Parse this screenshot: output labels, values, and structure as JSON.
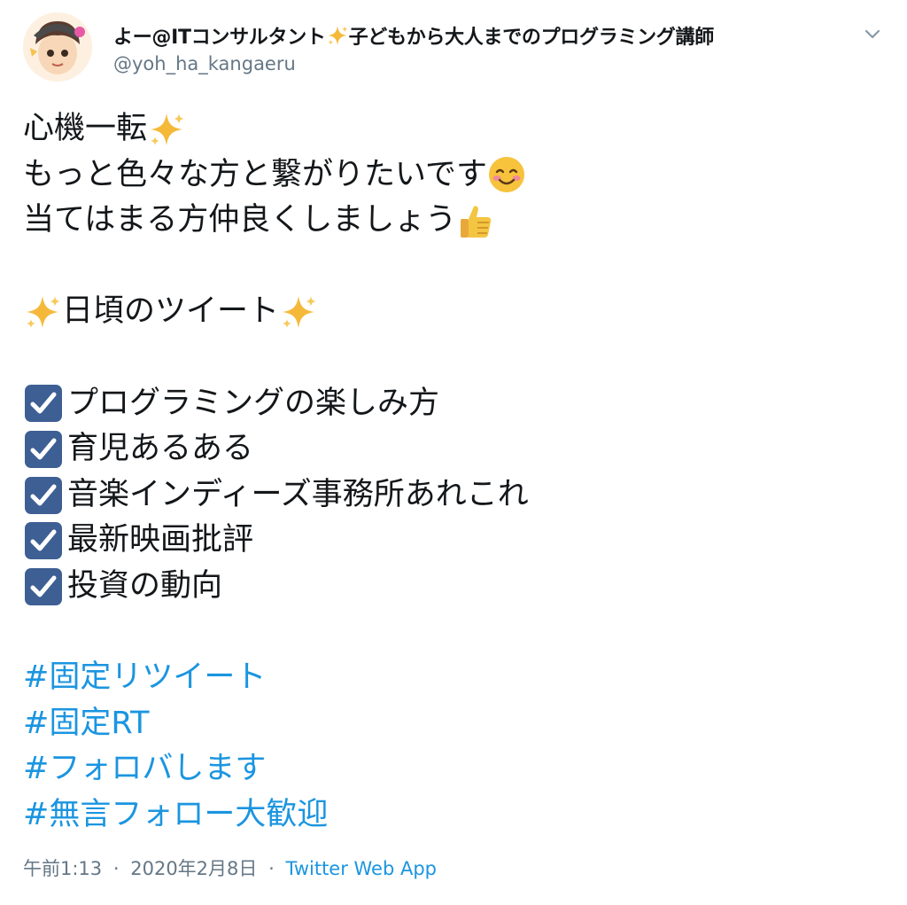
{
  "user": {
    "display_name": "よー@ITコンサルタント",
    "display_name_suffix": "子どもから大人までのプログラミング講師",
    "handle": "@yoh_ha_kangaeru"
  },
  "tweet": {
    "line1": "心機一転",
    "line2": "もっと色々な方と繋がりたいです",
    "line3": "当てはまる方仲良くしましょう",
    "section_title": "日頃のツイート",
    "topics": [
      "プログラミングの楽しみ方",
      "育児あるある",
      "音楽インディーズ事務所あれこれ",
      "最新映画批評",
      "投資の動向"
    ],
    "hashtags": [
      "#固定リツイート",
      "#固定RT",
      "#フォロバします",
      "#無言フォロー大歓迎"
    ]
  },
  "meta": {
    "time": "午前1:13",
    "separator": "·",
    "date": "2020年2月8日",
    "source": "Twitter Web App"
  },
  "icons": {
    "sparkles": "sparkles-icon",
    "smile": "smiling-face-icon",
    "thumbs_up": "thumbs-up-icon",
    "check": "check-box-icon",
    "chevron": "chevron-down-icon"
  },
  "colors": {
    "link": "#1b95e0",
    "secondary_text": "#657786",
    "text": "#14171a",
    "check_box": "#3b5998"
  }
}
